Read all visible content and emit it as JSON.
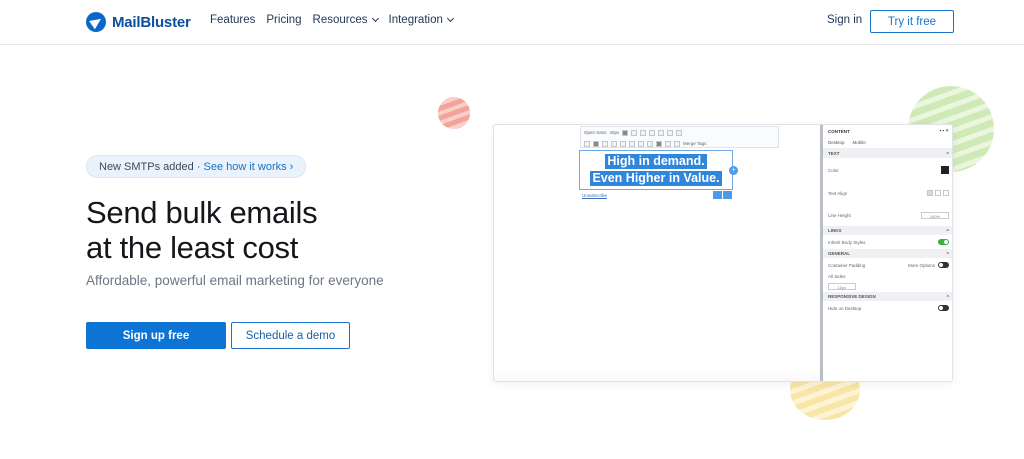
{
  "brand": {
    "name": "MailBluster",
    "color": "#0b67c9"
  },
  "nav": {
    "items": [
      {
        "label": "Features",
        "has_dropdown": false
      },
      {
        "label": "Pricing",
        "has_dropdown": false
      },
      {
        "label": "Resources",
        "has_dropdown": true
      },
      {
        "label": "Integration",
        "has_dropdown": true
      }
    ],
    "signin": "Sign in",
    "try_free": "Try it free"
  },
  "hero": {
    "pill_text": "New SMTPs added · ",
    "pill_link": "See how it works",
    "pill_arrow": "›",
    "headline_line1": "Send bulk emails",
    "headline_line2": "at the least cost",
    "subheadline": "Affordable, powerful email marketing for everyone",
    "cta_primary": "Sign up free",
    "cta_secondary": "Schedule a demo"
  },
  "editor_preview": {
    "toolbar": {
      "font": "Open Sans",
      "size": "40px",
      "merge_tags": "Merge Tags"
    },
    "selected_text_line1": "High in demand.",
    "selected_text_line2": "Even Higher in Value.",
    "unsubscribe": "Unsubscribe",
    "panel": {
      "title": "CONTENT",
      "tab_desktop": "Desktop",
      "tab_mobile": "Mobile",
      "sections": {
        "text": "TEXT",
        "links": "LINKS",
        "general": "GENERAL",
        "responsive": "RESPONSIVE DESIGN"
      },
      "rows": {
        "color": "Color",
        "text_align": "Text Align",
        "line_height": "Line Height",
        "line_height_value": "140%",
        "inherit_body": "Inherit Body Styles",
        "container_padding": "Container Padding",
        "more_options": "More Options",
        "all_sides": "All Sides",
        "padding_value": "10px",
        "hide_desktop": "Hide on Desktop"
      }
    }
  }
}
